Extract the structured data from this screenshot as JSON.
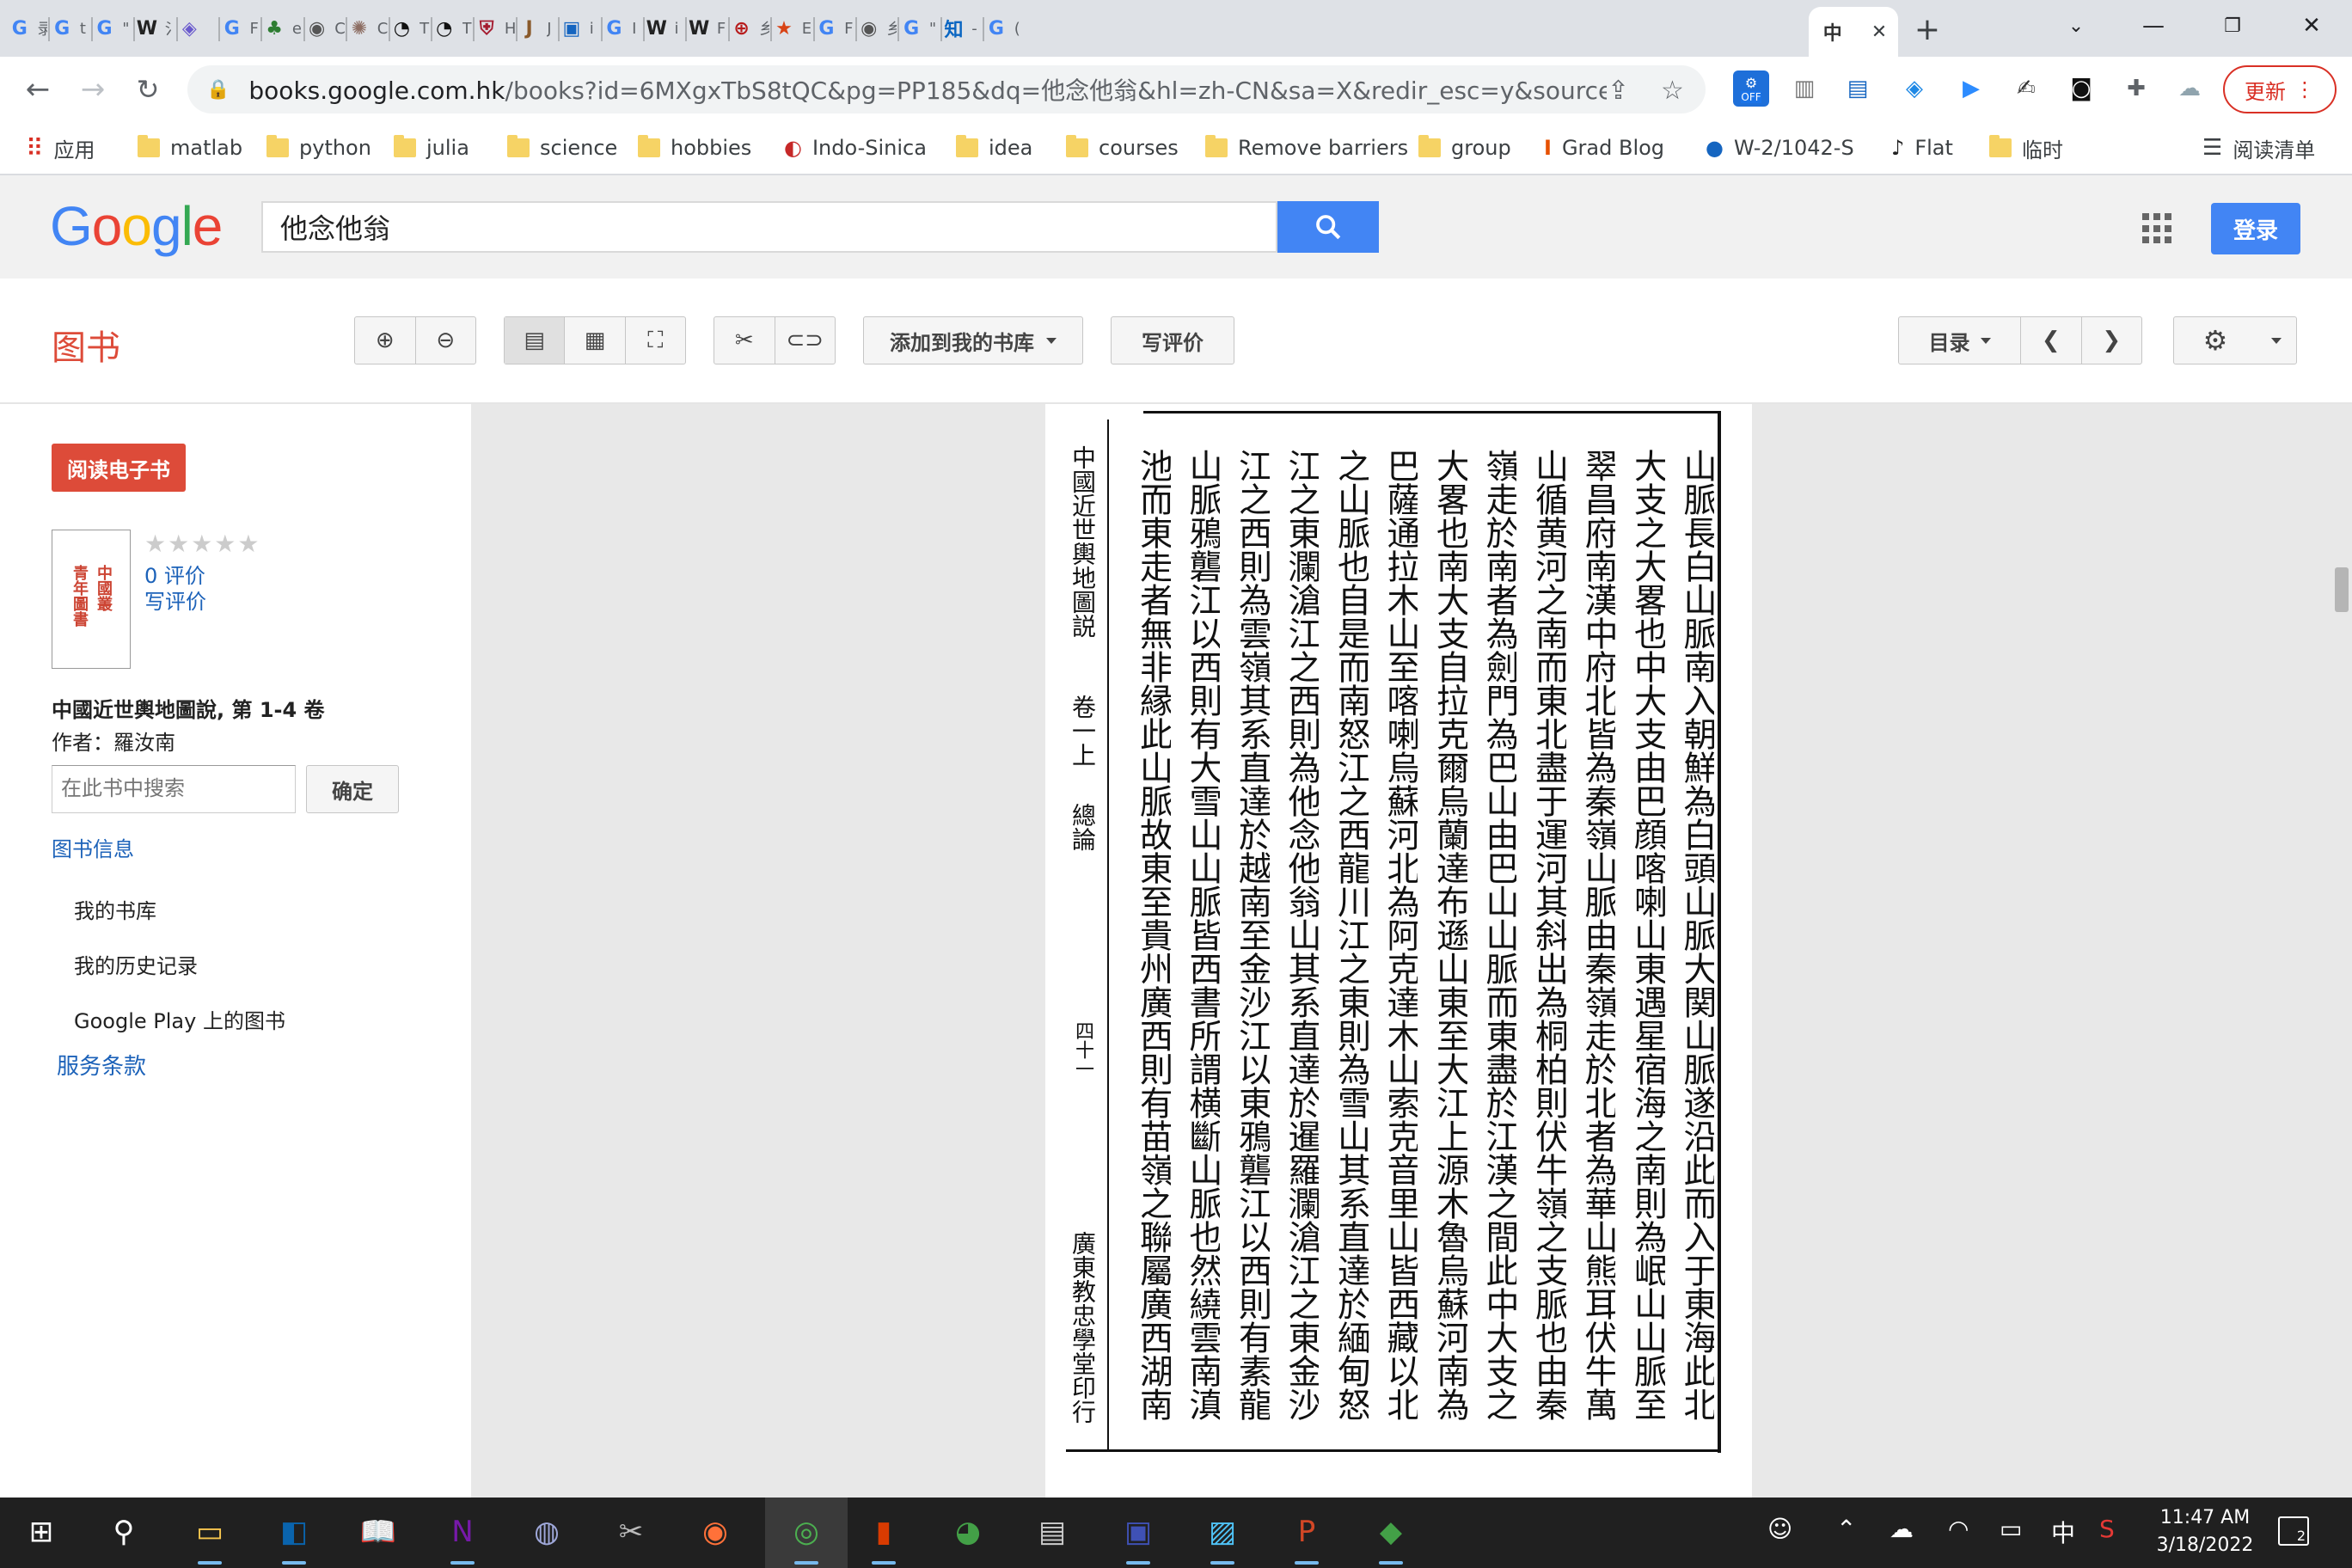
{
  "browser": {
    "tabs": [
      {
        "icon": "google-icon",
        "glyph": "G",
        "color": "#4285f4",
        "title": "录"
      },
      {
        "icon": "google-icon",
        "glyph": "G",
        "color": "#4285f4",
        "title": "t"
      },
      {
        "icon": "google-icon",
        "glyph": "G",
        "color": "#4285f4",
        "title": "\""
      },
      {
        "icon": "wikipedia-icon",
        "glyph": "W",
        "color": "#222222",
        "title": "氵"
      },
      {
        "icon": "diamond-icon",
        "glyph": "◈",
        "color": "#6a5acd",
        "title": ""
      },
      {
        "icon": "google-icon",
        "glyph": "G",
        "color": "#4285f4",
        "title": "F"
      },
      {
        "icon": "tree-icon",
        "glyph": "♣",
        "color": "#2e7d32",
        "title": "e"
      },
      {
        "icon": "globe-icon",
        "glyph": "◉",
        "color": "#555555",
        "title": "C"
      },
      {
        "icon": "seal-icon",
        "glyph": "✺",
        "color": "#8d6e63",
        "title": "C"
      },
      {
        "icon": "clock-icon",
        "glyph": "◔",
        "color": "#111111",
        "title": "T"
      },
      {
        "icon": "clock-icon",
        "glyph": "◔",
        "color": "#111111",
        "title": "T"
      },
      {
        "icon": "shield-icon",
        "glyph": "⛨",
        "color": "#a51c30",
        "title": "H"
      },
      {
        "icon": "j-icon",
        "glyph": "J",
        "color": "#8a5a2b",
        "title": "J"
      },
      {
        "icon": "book-icon",
        "glyph": "▣",
        "color": "#1565c0",
        "title": "i"
      },
      {
        "icon": "google-icon",
        "glyph": "G",
        "color": "#4285f4",
        "title": "I"
      },
      {
        "icon": "wikipedia-icon",
        "glyph": "W",
        "color": "#222222",
        "title": "i"
      },
      {
        "icon": "wikipedia-icon",
        "glyph": "W",
        "color": "#222222",
        "title": "F"
      },
      {
        "icon": "globe-icon",
        "glyph": "⊕",
        "color": "#b71c1c",
        "title": "乡"
      },
      {
        "icon": "star-icon",
        "glyph": "★",
        "color": "#d84315",
        "title": "E"
      },
      {
        "icon": "google-icon",
        "glyph": "G",
        "color": "#4285f4",
        "title": "F"
      },
      {
        "icon": "globe-icon",
        "glyph": "◉",
        "color": "#555555",
        "title": "乡"
      },
      {
        "icon": "google-icon",
        "glyph": "G",
        "color": "#4285f4",
        "title": "\""
      },
      {
        "icon": "zhihu-icon",
        "glyph": "知",
        "color": "#0a66c2",
        "title": "-"
      },
      {
        "icon": "google-icon",
        "glyph": "G",
        "color": "#4285f4",
        "title": "("
      },
      {
        "icon": "chinese-icon",
        "glyph": "中",
        "color": "#333333",
        "title": ""
      }
    ],
    "url_host": "books.google.com.hk",
    "url_path": "/books?id=6MXgxTbS8tQC&pg=PP185&dq=他念他翁&hl=zh-CN&sa=X&redir_esc=y&sourceid=cndr#...",
    "update_label": "更新",
    "ext_off_badge": "OFF",
    "bookmarks": [
      {
        "label": "应用",
        "type": "apps"
      },
      {
        "label": "matlab",
        "type": "folder"
      },
      {
        "label": "python",
        "type": "folder"
      },
      {
        "label": "julia",
        "type": "folder"
      },
      {
        "label": "science",
        "type": "folder"
      },
      {
        "label": "hobbies",
        "type": "folder"
      },
      {
        "label": "Indo-Sinica",
        "type": "site"
      },
      {
        "label": "idea",
        "type": "folder"
      },
      {
        "label": "courses",
        "type": "folder"
      },
      {
        "label": "Remove barriers",
        "type": "folder"
      },
      {
        "label": "group",
        "type": "folder"
      },
      {
        "label": "Grad Blog",
        "type": "site"
      },
      {
        "label": "W-2/1042-S",
        "type": "site"
      },
      {
        "label": "Flat",
        "type": "site"
      },
      {
        "label": "临时",
        "type": "folder"
      }
    ],
    "reading_list_label": "阅读清单"
  },
  "google": {
    "logo": "Google",
    "query": "他念他翁",
    "login_label": "登录"
  },
  "books_bar": {
    "title": "图书",
    "add_to_library": "添加到我的书库",
    "write_review": "写评价",
    "contents": "目录"
  },
  "left": {
    "read_ebook": "阅读电子书",
    "cover_text": [
      "中國叢",
      "青年圖書"
    ],
    "stars": "★★★★★",
    "reviews_count": "0 评价",
    "write_review": "写评价",
    "book_title": "中國近世輿地圖說, 第 1-4 卷",
    "author": "作者：羅汝南",
    "search_placeholder": "在此书中搜索",
    "search_button": "确定",
    "book_info": "图书信息",
    "menu": [
      "我的书库",
      "我的历史记录",
      "Google Play 上的图书"
    ],
    "terms": "服务条款"
  },
  "page_scan": {
    "columns": [
      "山脈長白山脈南入朝鮮為白頭山脈大関山脈遂沿此而入于東海此北",
      "大支之大畧也中大支由巴顔喀喇山東遇星宿海之南則為岷山山脈至",
      "翠昌府南漢中府北皆為秦嶺山脈由秦嶺走於北者為華山熊耳伏牛萬",
      "山循黄河之南而東北盡于運河其斜出為桐柏則伏牛嶺之支脈也由秦",
      "嶺走於南者為劍門為巴山由巴山山脈而東盡於江漢之間此中大支之",
      "大畧也南大支自拉克爾烏蘭達布遜山東至大江上源木魯烏蘇河南為",
      "巴薩通拉木山至喀喇烏蘇河北為阿克達木山索克音里山皆西藏以北",
      "之山脈也自是而南怒江之西龍川江之東則為雪山其系直達於緬甸怒",
      "江之東瀾滄江之西則為他念他翁山其系直達於暹羅瀾滄江之東金沙",
      "江之西則為雲嶺其系直達於越南至金沙江以東鴉礱江以西則有素龍",
      "山脈鴉礱江以西則有大雪山山脈皆西書所謂横斷山脈也然繞雲南滇",
      "池而東走者無非縁此山脈故東至貴州廣西則有苗嶺之聯屬廣西湖南"
    ],
    "margin_title": "中國近世輿地圖説",
    "margin_volume": "卷一上",
    "margin_section": "總論",
    "page_number": "四十一",
    "margin_printer": "廣東教忠學堂印行"
  },
  "taskbar": {
    "time": "11:47 AM",
    "date": "3/18/2022",
    "ime": "中",
    "notification_count": "2"
  }
}
